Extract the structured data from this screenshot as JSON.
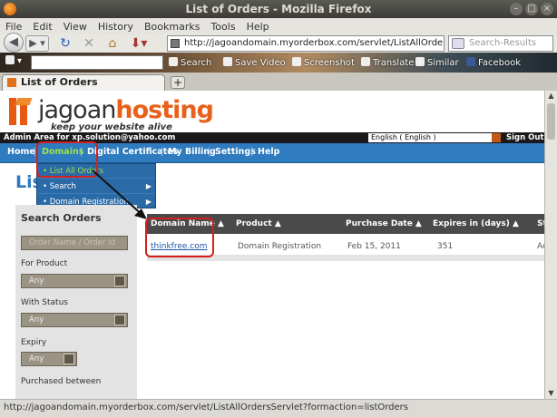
{
  "window": {
    "title": "List of Orders - Mozilla Firefox"
  },
  "menu": [
    "File",
    "Edit",
    "View",
    "History",
    "Bookmarks",
    "Tools",
    "Help"
  ],
  "nav": {
    "url": "http://jagoandomain.myorderbox.com/servlet/ListAllOrdersSe",
    "search_placeholder": "Search-Results"
  },
  "toolbar": {
    "items": [
      "Search",
      "Save Video",
      "Screenshot",
      "Translate",
      "Similar",
      "Facebook"
    ]
  },
  "tab": {
    "label": "List of Orders",
    "new_tab": "+"
  },
  "site": {
    "brand_part1": "jagoan",
    "brand_part2": "hosting",
    "tagline": "keep your website alive",
    "admin_text": "Admin Area for xp.solution@yahoo.com",
    "language": "English ( English )",
    "signout": "Sign Out"
  },
  "mainnav": {
    "items": [
      "Home",
      "Domains",
      "Digital Certificates",
      "My Billing",
      "Settings",
      "Help"
    ]
  },
  "dropdown": {
    "items": [
      "• List All Orders",
      "• Search",
      "• Domain Registration"
    ]
  },
  "page": {
    "heading": "List"
  },
  "sidebar": {
    "title": "Search Orders",
    "name_placeholder": "Order Name / Order Id",
    "product_label": "For Product",
    "product_value": "Any",
    "status_label": "With Status",
    "status_value": "Any",
    "expiry_label": "Expiry",
    "expiry_value": "Any",
    "purchased_label": "Purchased between"
  },
  "orders": {
    "columns": [
      "Domain Name ▲",
      "Product ▲",
      "Purchase Date ▲",
      "Expires in (days) ▲",
      "St"
    ],
    "rows": [
      {
        "domain": "thinkfree.com",
        "product": "Domain Registration",
        "purchase_date": "Feb 15, 2011",
        "expires": "351",
        "status": "Ac"
      }
    ]
  },
  "status": {
    "text": "http://jagoandomain.myorderbox.com/servlet/ListAllOrdersServlet?formaction=listOrders"
  },
  "colors": {
    "nav_blue": "#2e7bbf",
    "active_green": "#9fe04a",
    "brand_orange": "#e8601a",
    "highlight_red": "#d41f1f"
  }
}
